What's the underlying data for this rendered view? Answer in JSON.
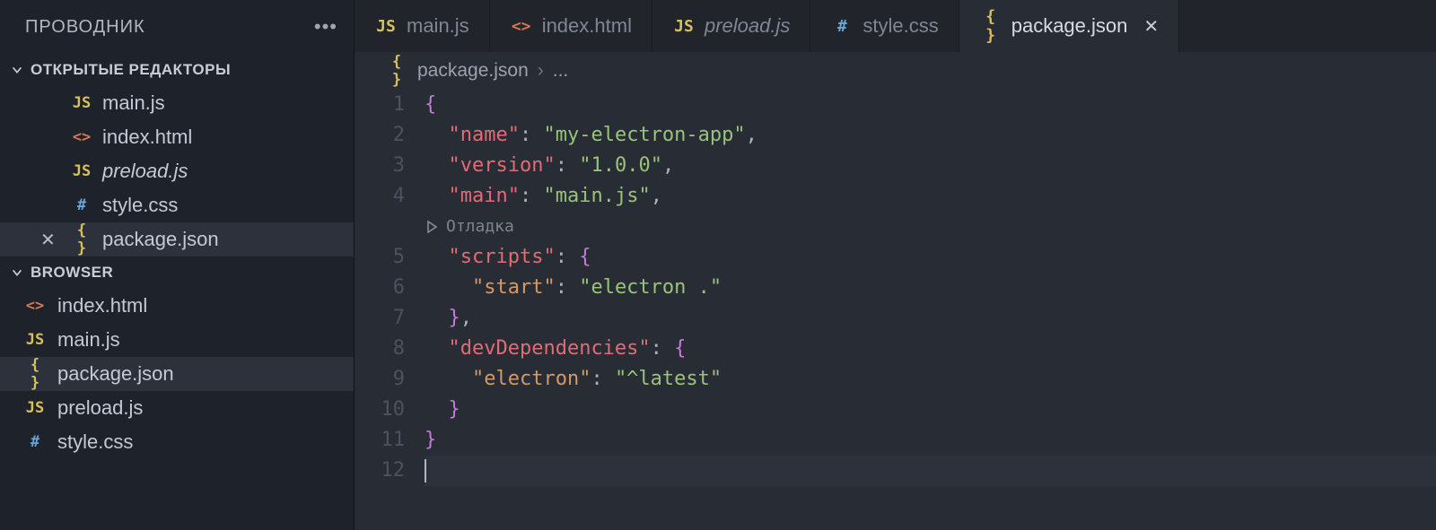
{
  "sidebar": {
    "title": "ПРОВОДНИК",
    "sections": {
      "openEditors": {
        "label": "ОТКРЫТЫЕ РЕДАКТОРЫ",
        "items": [
          {
            "icon": "js",
            "name": "main.js",
            "italic": false,
            "close": false
          },
          {
            "icon": "html",
            "name": "index.html",
            "italic": false,
            "close": false
          },
          {
            "icon": "js",
            "name": "preload.js",
            "italic": true,
            "close": false
          },
          {
            "icon": "css",
            "name": "style.css",
            "italic": false,
            "close": false
          },
          {
            "icon": "json",
            "name": "package.json",
            "italic": false,
            "close": true,
            "active": true
          }
        ]
      },
      "browser": {
        "label": "BROWSER",
        "items": [
          {
            "icon": "html",
            "name": "index.html"
          },
          {
            "icon": "js",
            "name": "main.js"
          },
          {
            "icon": "json",
            "name": "package.json",
            "active": true
          },
          {
            "icon": "js",
            "name": "preload.js"
          },
          {
            "icon": "css",
            "name": "style.css"
          }
        ]
      }
    }
  },
  "tabs": [
    {
      "icon": "js",
      "name": "main.js",
      "italic": false,
      "active": false
    },
    {
      "icon": "html",
      "name": "index.html",
      "italic": false,
      "active": false
    },
    {
      "icon": "js",
      "name": "preload.js",
      "italic": true,
      "active": false
    },
    {
      "icon": "css",
      "name": "style.css",
      "italic": false,
      "active": false
    },
    {
      "icon": "json",
      "name": "package.json",
      "italic": false,
      "active": true
    }
  ],
  "breadcrumb": {
    "icon": "json",
    "file": "package.json",
    "rest": "..."
  },
  "codelens": {
    "label": "Отладка"
  },
  "code": {
    "lines": 12,
    "content": {
      "name_key": "\"name\"",
      "name_val": "\"my-electron-app\"",
      "version_key": "\"version\"",
      "version_val": "\"1.0.0\"",
      "main_key": "\"main\"",
      "main_val": "\"main.js\"",
      "scripts_key": "\"scripts\"",
      "start_key": "\"start\"",
      "start_val": "\"electron .\"",
      "devdeps_key": "\"devDependencies\"",
      "electron_key": "\"electron\"",
      "electron_val": "\"^latest\""
    }
  },
  "iconGlyph": {
    "js": "JS",
    "html": "<>",
    "css": "#",
    "json": "{ }"
  }
}
